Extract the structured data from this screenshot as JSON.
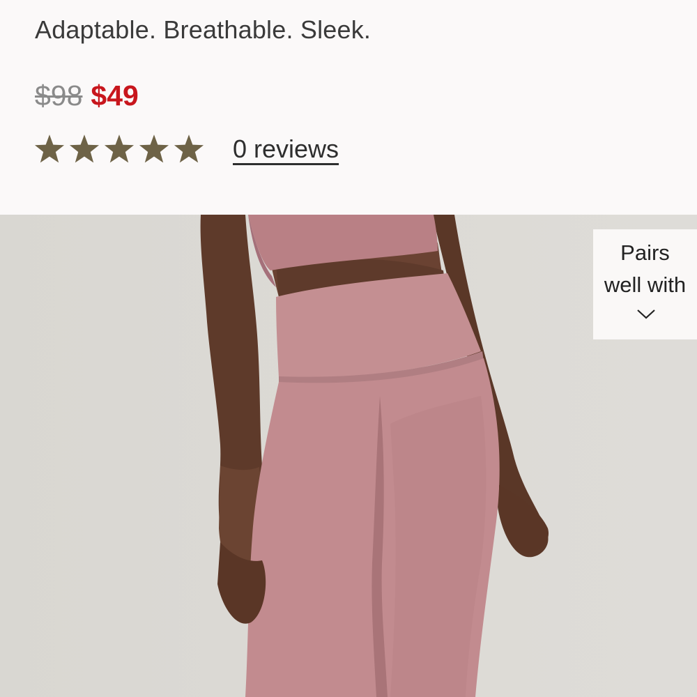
{
  "product": {
    "subtitle": "Adaptable. Breathable. Sleek.",
    "price_original": "$98",
    "price_sale": "$49",
    "rating": {
      "stars": 5,
      "reviews_label": "0 reviews"
    },
    "colors": {
      "sale_price": "#c8161d",
      "original_price": "#8a8a8a",
      "star": "#6e6347"
    }
  },
  "hero": {
    "icons": {
      "star": "star-icon",
      "chevron": "chevron-down-icon"
    },
    "pairs_panel": {
      "line1": "Pairs",
      "line2": "well with"
    }
  }
}
